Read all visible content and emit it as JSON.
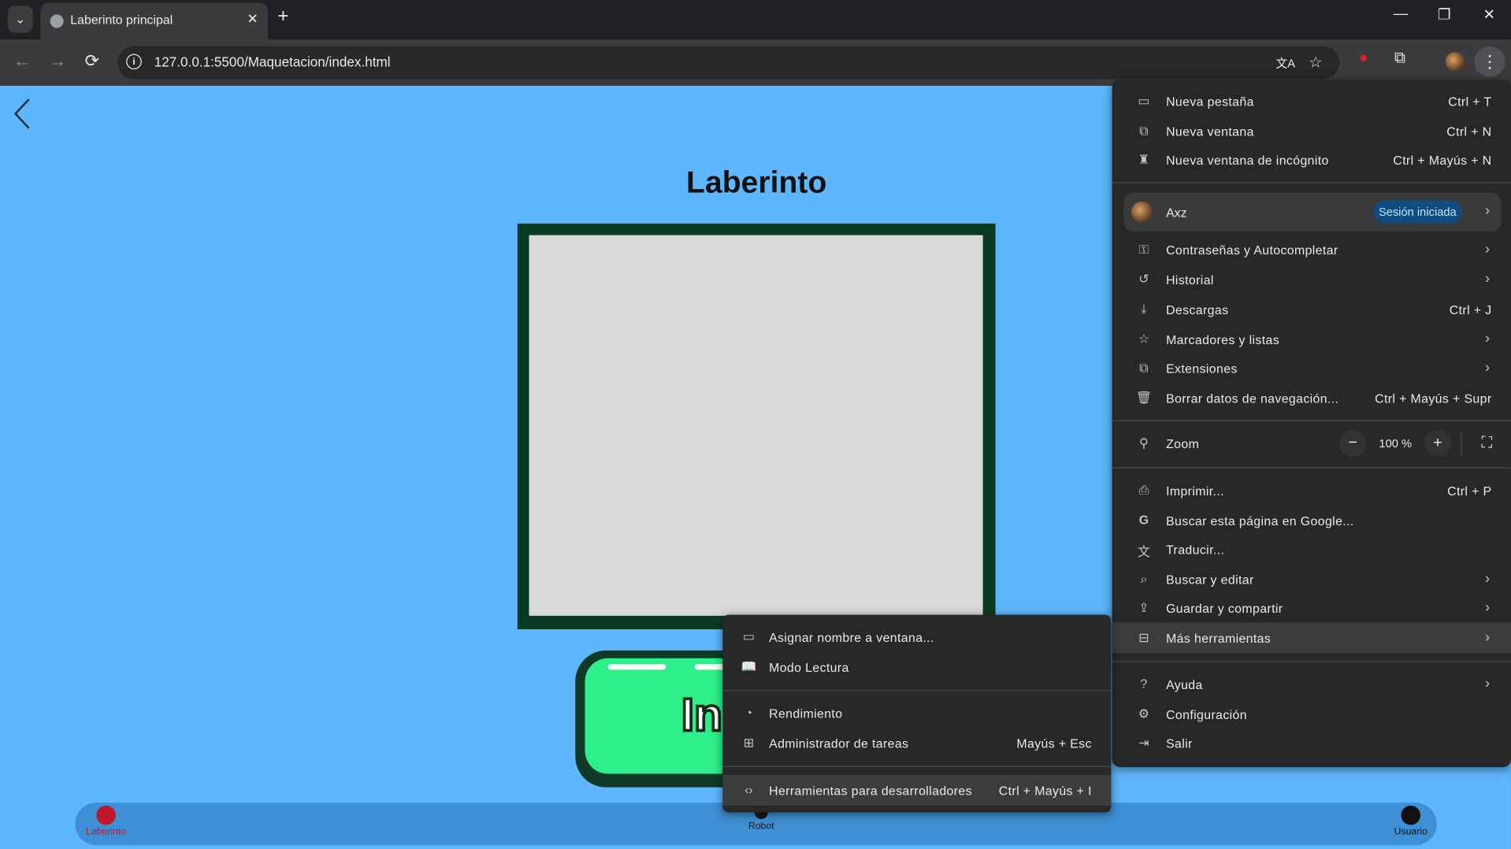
{
  "browser": {
    "tab": {
      "title": "Laberinto principal",
      "close": "✕"
    },
    "tab_dropdown": "⌄",
    "new_tab": "+",
    "window_controls": {
      "minimize": "—",
      "restore": "❐",
      "close": "✕"
    },
    "url": "127.0.0.1:5500/Maquetacion/index.html",
    "site_info": "i",
    "icons": {
      "back": "←",
      "forward": "→",
      "reload": "⟳",
      "translate": "文A",
      "star": "☆",
      "extension_red": "●",
      "extensions": "⧉",
      "menu": "⋮"
    }
  },
  "page": {
    "background_color": "#5eb7fc",
    "title": "Laberinto",
    "start_button_label": "In",
    "bottom_nav": [
      {
        "label": "Laberinto",
        "color": "#c0172c"
      },
      {
        "label": "Robot",
        "color": "#1a1a1a"
      },
      {
        "label": "Usuario",
        "color": "#111111"
      }
    ]
  },
  "chrome_menu": {
    "group1": [
      {
        "icon": "▭",
        "label": "Nueva pestaña",
        "shortcut": "Ctrl + T"
      },
      {
        "icon": "⧉",
        "label": "Nueva ventana",
        "shortcut": "Ctrl + N"
      },
      {
        "icon": "♜",
        "label": "Nueva ventana de incógnito",
        "shortcut": "Ctrl + Mayús + N"
      }
    ],
    "profile": {
      "name": "Axz",
      "badge": "Sesión iniciada",
      "chevron": "›"
    },
    "group2": [
      {
        "icon": "⚿",
        "label": "Contraseñas y Autocompletar",
        "chevron": "›"
      },
      {
        "icon": "↺",
        "label": "Historial",
        "chevron": "›"
      },
      {
        "icon": "⤓",
        "label": "Descargas",
        "shortcut": "Ctrl + J"
      },
      {
        "icon": "☆",
        "label": "Marcadores y listas",
        "chevron": "›"
      },
      {
        "icon": "⧉",
        "label": "Extensiones",
        "chevron": "›"
      },
      {
        "icon": "🗑",
        "label": "Borrar datos de navegación...",
        "shortcut": "Ctrl + Mayús + Supr"
      }
    ],
    "zoom": {
      "icon": "⚲",
      "label": "Zoom",
      "minus": "−",
      "value": "100 %",
      "plus": "+",
      "fullscreen": "⛶"
    },
    "group3": [
      {
        "icon": "⎙",
        "label": "Imprimir...",
        "shortcut": "Ctrl + P"
      },
      {
        "icon": "G",
        "label": "Buscar esta página en Google..."
      },
      {
        "icon": "文",
        "label": "Traducir..."
      },
      {
        "icon": "⌕",
        "label": "Buscar y editar",
        "chevron": "›"
      },
      {
        "icon": "⇪",
        "label": "Guardar y compartir",
        "chevron": "›"
      },
      {
        "icon": "⊟",
        "label": "Más herramientas",
        "chevron": "›"
      }
    ],
    "group4": [
      {
        "icon": "?",
        "label": "Ayuda",
        "chevron": "›"
      },
      {
        "icon": "⚙",
        "label": "Configuración"
      },
      {
        "icon": "⇥",
        "label": "Salir"
      }
    ]
  },
  "more_tools_submenu": [
    {
      "icon": "▭",
      "label": "Asignar nombre a ventana..."
    },
    {
      "icon": "📖",
      "label": "Modo Lectura"
    },
    {
      "icon": "◔",
      "label": "Rendimiento"
    },
    {
      "icon": "⊞",
      "label": "Administrador de tareas",
      "shortcut": "Mayús + Esc"
    },
    {
      "icon": "‹›",
      "label": "Herramientas para desarrolladores",
      "shortcut": "Ctrl + Mayús + I"
    }
  ]
}
